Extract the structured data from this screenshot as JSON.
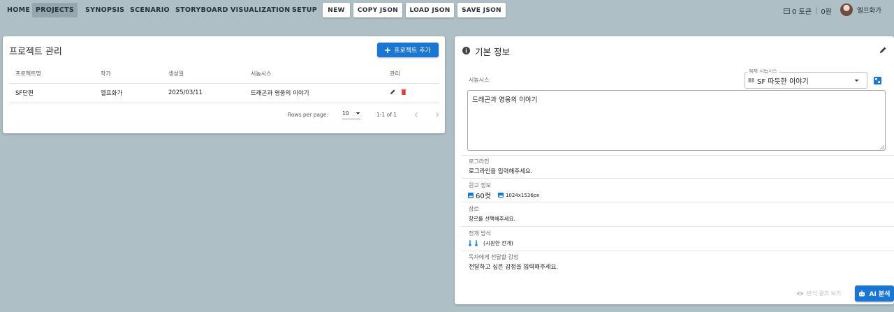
{
  "nav": {
    "items": [
      {
        "label": "HOME"
      },
      {
        "label": "PROJECTS"
      },
      {
        "label": "SYNOPSIS"
      },
      {
        "label": "SCENARIO"
      },
      {
        "label": "STORYBOARD"
      },
      {
        "label": "VISUALIZATION"
      },
      {
        "label": "SETUP"
      }
    ],
    "active": "PROJECTS"
  },
  "toolbar": {
    "new_label": "NEW",
    "copy_label": "COPY JSON",
    "load_label": "LOAD JSON",
    "save_label": "SAVE JSON"
  },
  "account": {
    "tokens": "0 토큰",
    "separator": "|",
    "balance": "0원",
    "username": "엘프화가"
  },
  "projects": {
    "title": "프로젝트 관리",
    "add_label": "프로젝트 추가",
    "columns": [
      "프로젝트명",
      "작가",
      "생성일",
      "시놉시스",
      "관리"
    ],
    "rows": [
      {
        "name": "SF단편",
        "author": "엘프화가",
        "date": "2025/03/11",
        "synopsis": "드래곤과 영웅의 이야기"
      }
    ],
    "rows_per_page_label": "Rows per page:",
    "rows_per_page": "10",
    "range": "1-1 of 1"
  },
  "basic_info": {
    "title": "기본 정보",
    "synopsis_label": "시놉시스",
    "example_label": "예제 시놉시스",
    "example_value": "SF 따듯한 이야기",
    "synopsis_text": "드래곤과 영웅의 이야기",
    "logline_label": "로그라인",
    "logline_value": "로그라인을 입력해주세요.",
    "manuscript_label": "원고 정보",
    "cuts": "60컷",
    "resolution": "1024x1536px",
    "genre_label": "장르",
    "genre_value": "장르를 선택해주세요.",
    "development_label": "전개 방식",
    "development_value": "(시원한 전개)",
    "emotion_label": "독자에게 전달할 감정",
    "emotion_value": "전달하고 싶은 감정을 입력해주세요.",
    "analysis_result_label": "분석 결과 보기",
    "ai_analysis_label": "AI 분석"
  },
  "colors": {
    "primary": "#1976d2",
    "delete": "#e53935",
    "background": "#afbfc6"
  }
}
